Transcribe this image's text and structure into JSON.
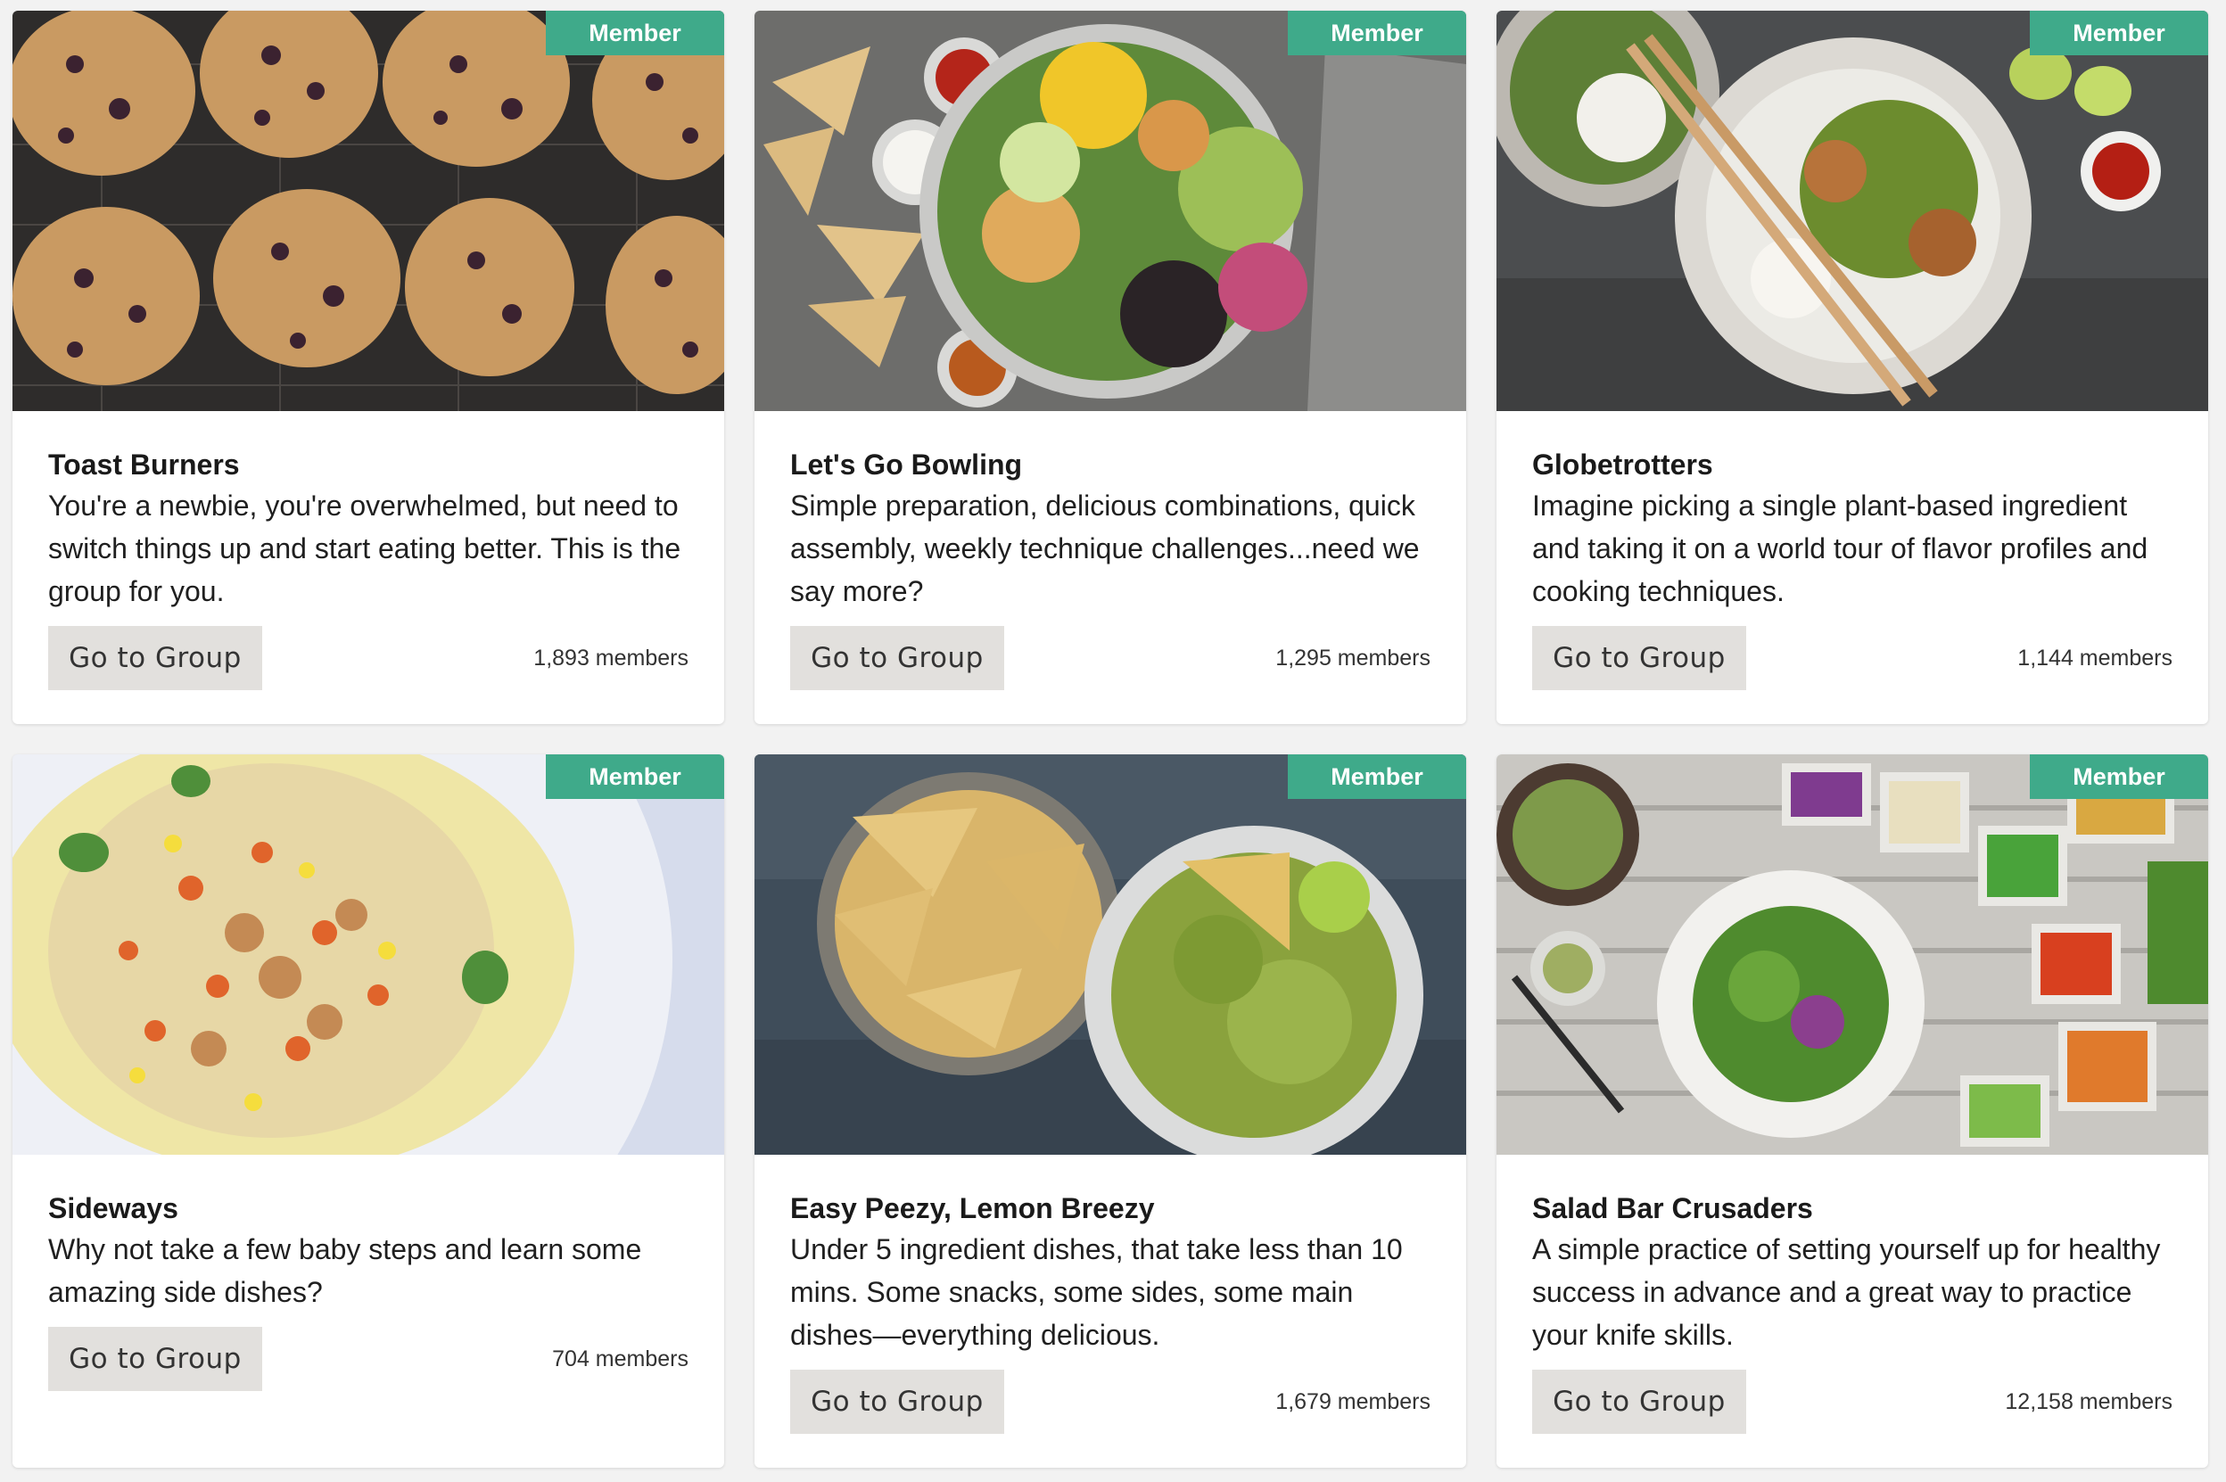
{
  "colors": {
    "page_background": "#f2f2f2",
    "card_background": "#ffffff",
    "badge": "#3faa8a",
    "button": "#e2e0dd"
  },
  "groups": [
    {
      "badge": "Member",
      "image_subject": "chocolate-chip-cookies-photo",
      "title": "Toast Burners",
      "description": "You're a newbie, you're overwhelmed, but need to switch things up and start eating better. This is the group for you.",
      "button_label": "Go to Group",
      "members": "1,893 members"
    },
    {
      "badge": "Member",
      "image_subject": "burrito-bowl-with-chips-photo",
      "title": "Let's Go Bowling",
      "description": "Simple preparation, delicious combinations, quick assembly, weekly technique challenges...need we say more?",
      "button_label": "Go to Group",
      "members": "1,295 members"
    },
    {
      "badge": "Member",
      "image_subject": "stir-fry-bowl-with-chopsticks-photo",
      "title": "Globetrotters",
      "description": "Imagine picking a single plant-based ingredient and taking it on a world tour of flavor profiles and cooking techniques.",
      "button_label": "Go to Group",
      "members": "1,144 members"
    },
    {
      "badge": "Member",
      "image_subject": "vegetable-rice-dish-photo",
      "title": "Sideways",
      "description": "Why not take a few baby steps and learn some amazing side dishes?",
      "button_label": "Go to Group",
      "members": "704 members"
    },
    {
      "badge": "Member",
      "image_subject": "guacamole-and-chips-photo",
      "title": "Easy Peezy, Lemon Breezy",
      "description": "Under 5 ingredient dishes, that take less than 10 mins. Some snacks, some sides, some main dishes—everything delicious.",
      "button_label": "Go to Group",
      "members": "1,679 members"
    },
    {
      "badge": "Member",
      "image_subject": "salad-bar-photo",
      "title": "Salad Bar Crusaders",
      "description": "A simple practice of setting yourself up for healthy success in advance and a great way to practice your knife skills.",
      "button_label": "Go to Group",
      "members": "12,158 members"
    }
  ]
}
